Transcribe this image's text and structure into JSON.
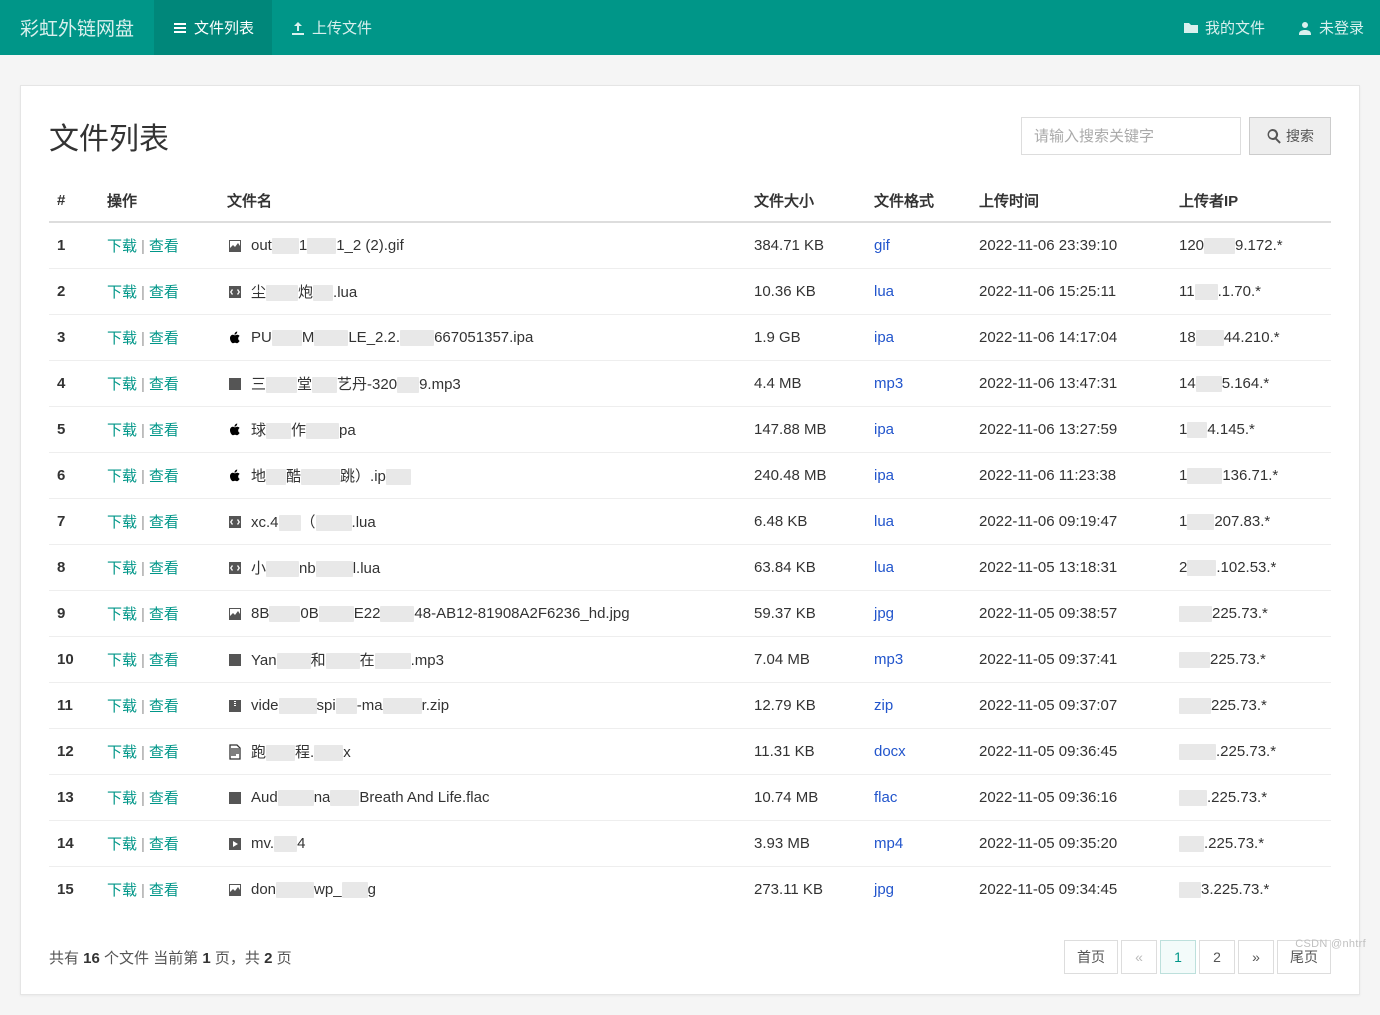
{
  "nav": {
    "brand": "彩虹外链网盘",
    "items": [
      {
        "key": "file-list",
        "label": "文件列表",
        "icon": "list",
        "active": true
      },
      {
        "key": "upload",
        "label": "上传文件",
        "icon": "upload",
        "active": false
      }
    ],
    "right": [
      {
        "key": "my-files",
        "label": "我的文件",
        "icon": "folder"
      },
      {
        "key": "not-login",
        "label": "未登录",
        "icon": "user"
      }
    ]
  },
  "page": {
    "title": "文件列表",
    "search_placeholder": "请输入搜索关键字",
    "search_btn": "搜索"
  },
  "table": {
    "headers": {
      "idx": "#",
      "op": "操作",
      "name": "文件名",
      "size": "文件大小",
      "fmt": "文件格式",
      "time": "上传时间",
      "ip": "上传者IP"
    },
    "op_labels": {
      "download": "下载",
      "view": "查看"
    },
    "cols": {
      "idx": "50px",
      "op": "120px",
      "name": "auto",
      "size": "120px",
      "fmt": "105px",
      "time": "200px",
      "ip": "160px"
    },
    "rows": [
      {
        "idx": 1,
        "icon": "image",
        "name_parts": [
          "out",
          null,
          "1",
          null,
          "1_2 (2).gif"
        ],
        "size": "384.71 KB",
        "fmt": "gif",
        "time": "2022-11-06 23:39:10",
        "ip_parts": [
          "120",
          null,
          "9.172.*"
        ]
      },
      {
        "idx": 2,
        "icon": "code",
        "name_parts": [
          "尘",
          null,
          "炮",
          null,
          ".lua"
        ],
        "size": "10.36 KB",
        "fmt": "lua",
        "time": "2022-11-06 15:25:11",
        "ip_parts": [
          "11",
          null,
          ".1.70.*"
        ]
      },
      {
        "idx": 3,
        "icon": "apple",
        "name_parts": [
          "PU",
          null,
          "M",
          null,
          "LE_2.2.",
          null,
          "667051357.ipa"
        ],
        "size": "1.9 GB",
        "fmt": "ipa",
        "time": "2022-11-06 14:17:04",
        "ip_parts": [
          "18",
          null,
          "44.210.*"
        ]
      },
      {
        "idx": 4,
        "icon": "audio",
        "name_parts": [
          "三",
          null,
          "堂",
          null,
          "艺丹-320",
          null,
          "9.mp3"
        ],
        "size": "4.4 MB",
        "fmt": "mp3",
        "time": "2022-11-06 13:47:31",
        "ip_parts": [
          "14",
          null,
          "5.164.*"
        ]
      },
      {
        "idx": 5,
        "icon": "apple",
        "name_parts": [
          "球",
          null,
          "作",
          null,
          "pa"
        ],
        "size": "147.88 MB",
        "fmt": "ipa",
        "time": "2022-11-06 13:27:59",
        "ip_parts": [
          "1",
          null,
          "4.145.*"
        ]
      },
      {
        "idx": 6,
        "icon": "apple",
        "name_parts": [
          "地",
          null,
          "酷",
          null,
          "跳）.ip",
          null
        ],
        "size": "240.48 MB",
        "fmt": "ipa",
        "time": "2022-11-06 11:23:38",
        "ip_parts": [
          "1",
          null,
          "136.71.*"
        ]
      },
      {
        "idx": 7,
        "icon": "code",
        "name_parts": [
          "xc.4",
          null,
          "（",
          null,
          ".lua"
        ],
        "size": "6.48 KB",
        "fmt": "lua",
        "time": "2022-11-06 09:19:47",
        "ip_parts": [
          "1",
          null,
          "207.83.*"
        ]
      },
      {
        "idx": 8,
        "icon": "code",
        "name_parts": [
          "小",
          null,
          "nb",
          null,
          "l.lua"
        ],
        "size": "63.84 KB",
        "fmt": "lua",
        "time": "2022-11-05 13:18:31",
        "ip_parts": [
          "2",
          null,
          ".102.53.*"
        ]
      },
      {
        "idx": 9,
        "icon": "image",
        "name_parts": [
          "8B",
          null,
          "0B",
          null,
          "E22",
          null,
          "48-AB12-81908A2F6236_hd.jpg"
        ],
        "size": "59.37 KB",
        "fmt": "jpg",
        "time": "2022-11-05 09:38:57",
        "ip_parts": [
          null,
          "225.73.*"
        ]
      },
      {
        "idx": 10,
        "icon": "audio",
        "name_parts": [
          "Yan",
          null,
          "和",
          null,
          "在",
          null,
          ".mp3"
        ],
        "size": "7.04 MB",
        "fmt": "mp3",
        "time": "2022-11-05 09:37:41",
        "ip_parts": [
          null,
          "225.73.*"
        ]
      },
      {
        "idx": 11,
        "icon": "archive",
        "name_parts": [
          "vide",
          null,
          "spi",
          null,
          "-ma",
          null,
          "r.zip"
        ],
        "size": "12.79 KB",
        "fmt": "zip",
        "time": "2022-11-05 09:37:07",
        "ip_parts": [
          null,
          "225.73.*"
        ]
      },
      {
        "idx": 12,
        "icon": "doc",
        "name_parts": [
          "跑",
          null,
          "程.",
          null,
          "x"
        ],
        "size": "11.31 KB",
        "fmt": "docx",
        "time": "2022-11-05 09:36:45",
        "ip_parts": [
          null,
          ".225.73.*"
        ]
      },
      {
        "idx": 13,
        "icon": "audio",
        "name_parts": [
          "Aud",
          null,
          "na",
          null,
          "Breath And Life.flac"
        ],
        "size": "10.74 MB",
        "fmt": "flac",
        "time": "2022-11-05 09:36:16",
        "ip_parts": [
          null,
          ".225.73.*"
        ]
      },
      {
        "idx": 14,
        "icon": "video",
        "name_parts": [
          "mv.",
          null,
          "4"
        ],
        "size": "3.93 MB",
        "fmt": "mp4",
        "time": "2022-11-05 09:35:20",
        "ip_parts": [
          null,
          ".225.73.*"
        ]
      },
      {
        "idx": 15,
        "icon": "image",
        "name_parts": [
          "don",
          null,
          "wp_",
          null,
          "g"
        ],
        "size": "273.11 KB",
        "fmt": "jpg",
        "time": "2022-11-05 09:34:45",
        "ip_parts": [
          null,
          "3.225.73.*"
        ]
      }
    ]
  },
  "footer": {
    "text_prefix": "共有 ",
    "total": "16",
    "text_mid1": " 个文件  当前第 ",
    "page": "1",
    "text_mid2": " 页，共 ",
    "pages": "2",
    "text_suffix": " 页",
    "pagination": {
      "first": "首页",
      "prev": "«",
      "p1": "1",
      "p2": "2",
      "next": "»",
      "last": "尾页"
    }
  },
  "watermark": "CSDN @nhtrf"
}
